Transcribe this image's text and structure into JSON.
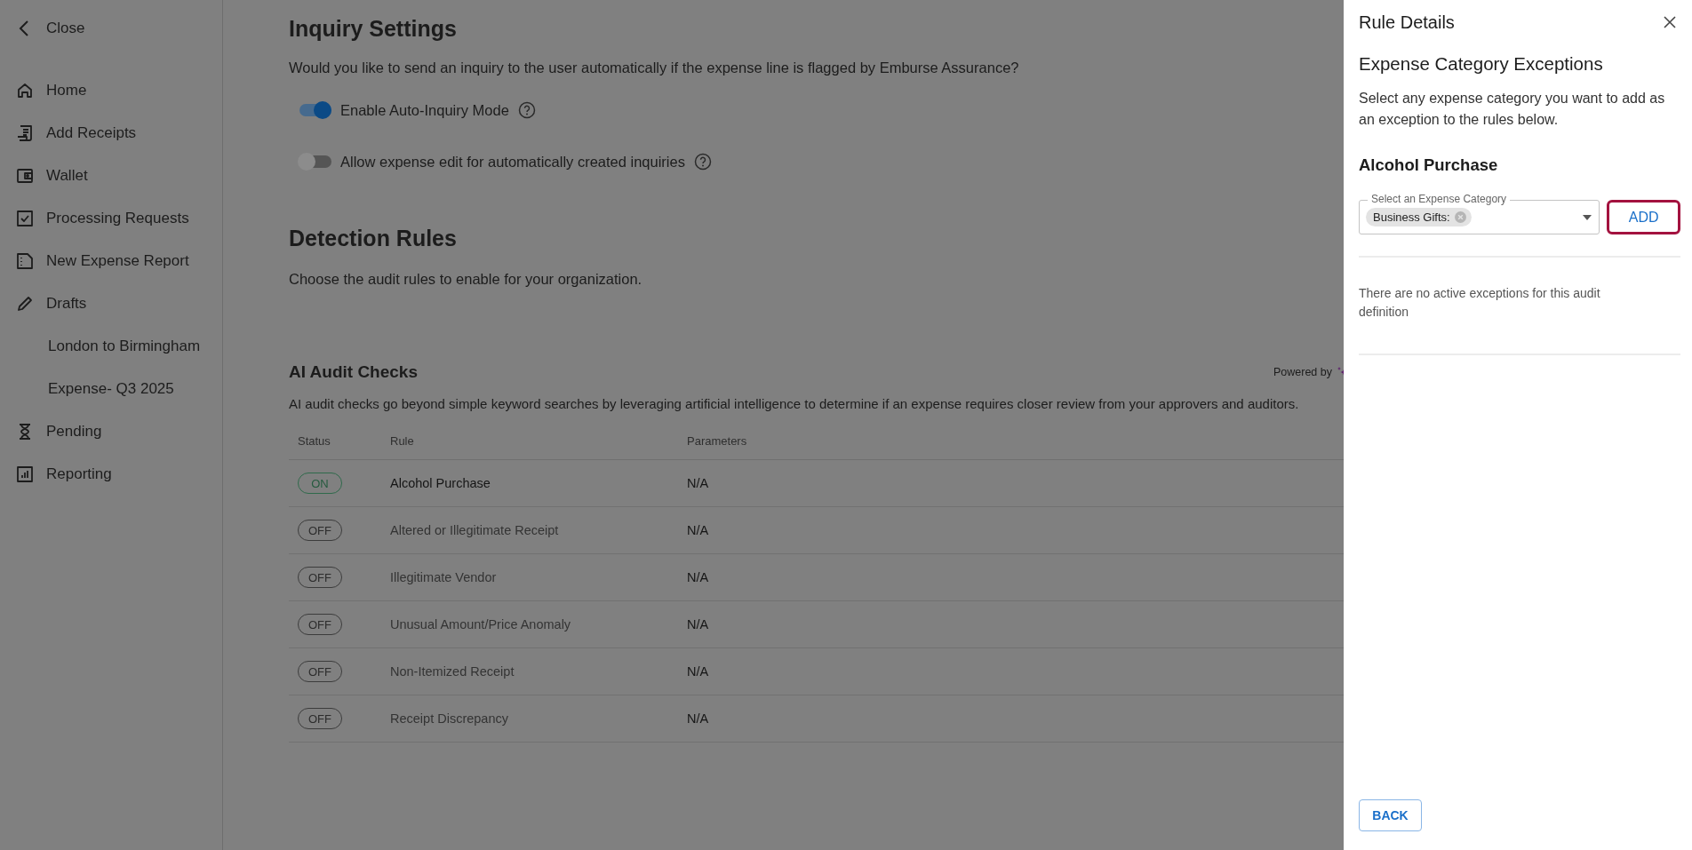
{
  "sidebar": {
    "close_label": "Close",
    "items": [
      {
        "label": "Home"
      },
      {
        "label": "Add Receipts"
      },
      {
        "label": "Wallet"
      },
      {
        "label": "Processing Requests"
      },
      {
        "label": "New Expense Report"
      },
      {
        "label": "Drafts",
        "children": [
          {
            "label": "London to Birmingham"
          },
          {
            "label": "Expense- Q3 2025"
          }
        ]
      },
      {
        "label": "Pending"
      },
      {
        "label": "Reporting"
      }
    ]
  },
  "inquiry_settings": {
    "title": "Inquiry Settings",
    "question": "Would you like to send an inquiry to the user automatically if the expense line is flagged by Emburse Assurance?",
    "toggles": [
      {
        "label": "Enable Auto-Inquiry Mode",
        "on": true
      },
      {
        "label": "Allow expense edit for automatically created inquiries",
        "on": false
      }
    ]
  },
  "detection_rules": {
    "title": "Detection Rules",
    "description": "Choose the audit rules to enable for your organization."
  },
  "ai_audit_checks": {
    "title": "AI Audit Checks",
    "powered_by": "Powered by",
    "description": "AI audit checks go beyond simple keyword searches by leveraging artificial intelligence to determine if an expense requires closer review from your approvers and auditors.",
    "columns": [
      "Status",
      "Rule",
      "Parameters"
    ],
    "rows": [
      {
        "status": "ON",
        "on": true,
        "rule": "Alcohol Purchase",
        "parameters": "N/A"
      },
      {
        "status": "OFF",
        "on": false,
        "rule": "Altered or Illegitimate Receipt",
        "parameters": "N/A"
      },
      {
        "status": "OFF",
        "on": false,
        "rule": "Illegitimate Vendor",
        "parameters": "N/A"
      },
      {
        "status": "OFF",
        "on": false,
        "rule": "Unusual Amount/Price Anomaly",
        "parameters": "N/A"
      },
      {
        "status": "OFF",
        "on": false,
        "rule": "Non-Itemized Receipt",
        "parameters": "N/A"
      },
      {
        "status": "OFF",
        "on": false,
        "rule": "Receipt Discrepancy",
        "parameters": "N/A"
      }
    ]
  },
  "drawer": {
    "title": "Rule Details",
    "heading": "Expense Category Exceptions",
    "description": "Select any expense category you want to add as an exception to the rules below.",
    "rule_name": "Alcohol Purchase",
    "field": {
      "label": "Select an Expense Category",
      "chips": [
        {
          "label": "Business Gifts:"
        }
      ]
    },
    "add_button": {
      "label": "ADD",
      "focused": true
    },
    "empty_message": "There are no active exceptions for this audit definition",
    "back_button": "BACK"
  }
}
